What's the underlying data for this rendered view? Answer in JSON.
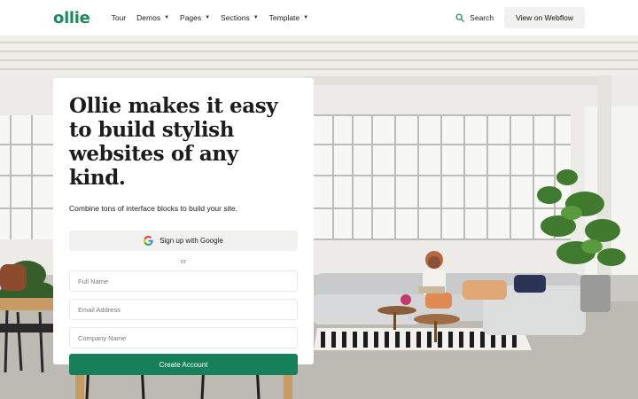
{
  "header": {
    "logo": "ollie",
    "nav": [
      {
        "label": "Tour",
        "dropdown": false
      },
      {
        "label": "Demos",
        "dropdown": true
      },
      {
        "label": "Pages",
        "dropdown": true
      },
      {
        "label": "Sections",
        "dropdown": true
      },
      {
        "label": "Template",
        "dropdown": true
      }
    ],
    "search_label": "Search",
    "webflow_label": "View on Webflow"
  },
  "card": {
    "headline": "Ollie makes it easy to build stylish websites of any kind.",
    "subtitle": "Combine tons of interface blocks to build your site.",
    "google_label": "Sign up with Google",
    "or_label": "or",
    "fields": {
      "full_name": "Full Name",
      "email": "Email Address",
      "company": "Company Name"
    },
    "cta_label": "Create Account"
  },
  "colors": {
    "brand": "#1c8a5c",
    "cta": "#158059",
    "button_bg": "#f1f1ef"
  },
  "icons": [
    "search-icon",
    "google-icon",
    "chevron-down-icon"
  ]
}
